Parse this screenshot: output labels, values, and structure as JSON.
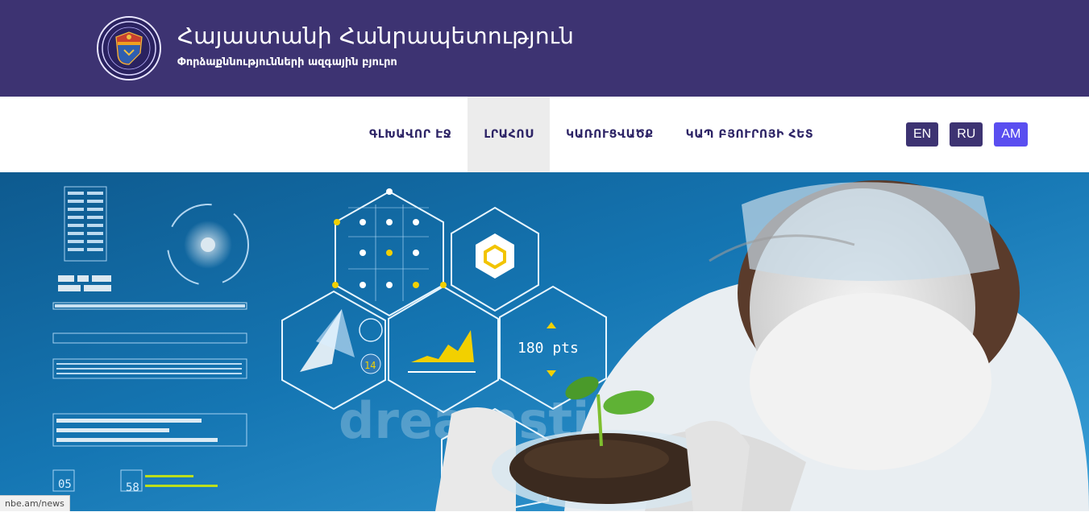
{
  "header": {
    "title": "Հայաստանի Հանրապետություն",
    "subtitle": "Փորձաքննությունների ազգային բյուրո",
    "emblem_icon": "bureau-emblem-icon"
  },
  "nav": {
    "items": [
      {
        "label": "ԳԼԽԱՎՈՐ ԷՋ",
        "active": false
      },
      {
        "label": "ԼՐԱՀՈՍ",
        "active": true
      },
      {
        "label": "ԿԱՌՈՒՑՎԱԾՔ",
        "active": false
      },
      {
        "label": "ԿԱՊ ԲՅՈՒՐՈՅԻ ՀԵՏ",
        "active": false
      }
    ]
  },
  "languages": [
    {
      "code": "EN",
      "active": false
    },
    {
      "code": "RU",
      "active": false
    },
    {
      "code": "AM",
      "active": true
    }
  ],
  "hero": {
    "readout_text": "180 pts",
    "small_numbers": [
      "14",
      "05",
      "58"
    ],
    "watermark": "dreamstime"
  },
  "status_bar": {
    "url": "nbe.am/news"
  },
  "colors": {
    "header_bg": "#3d3372",
    "nav_text": "#2d2466",
    "active_nav_bg": "#ececec",
    "lang_bg": "#3d3372",
    "lang_active_bg": "#5a4ef0"
  }
}
